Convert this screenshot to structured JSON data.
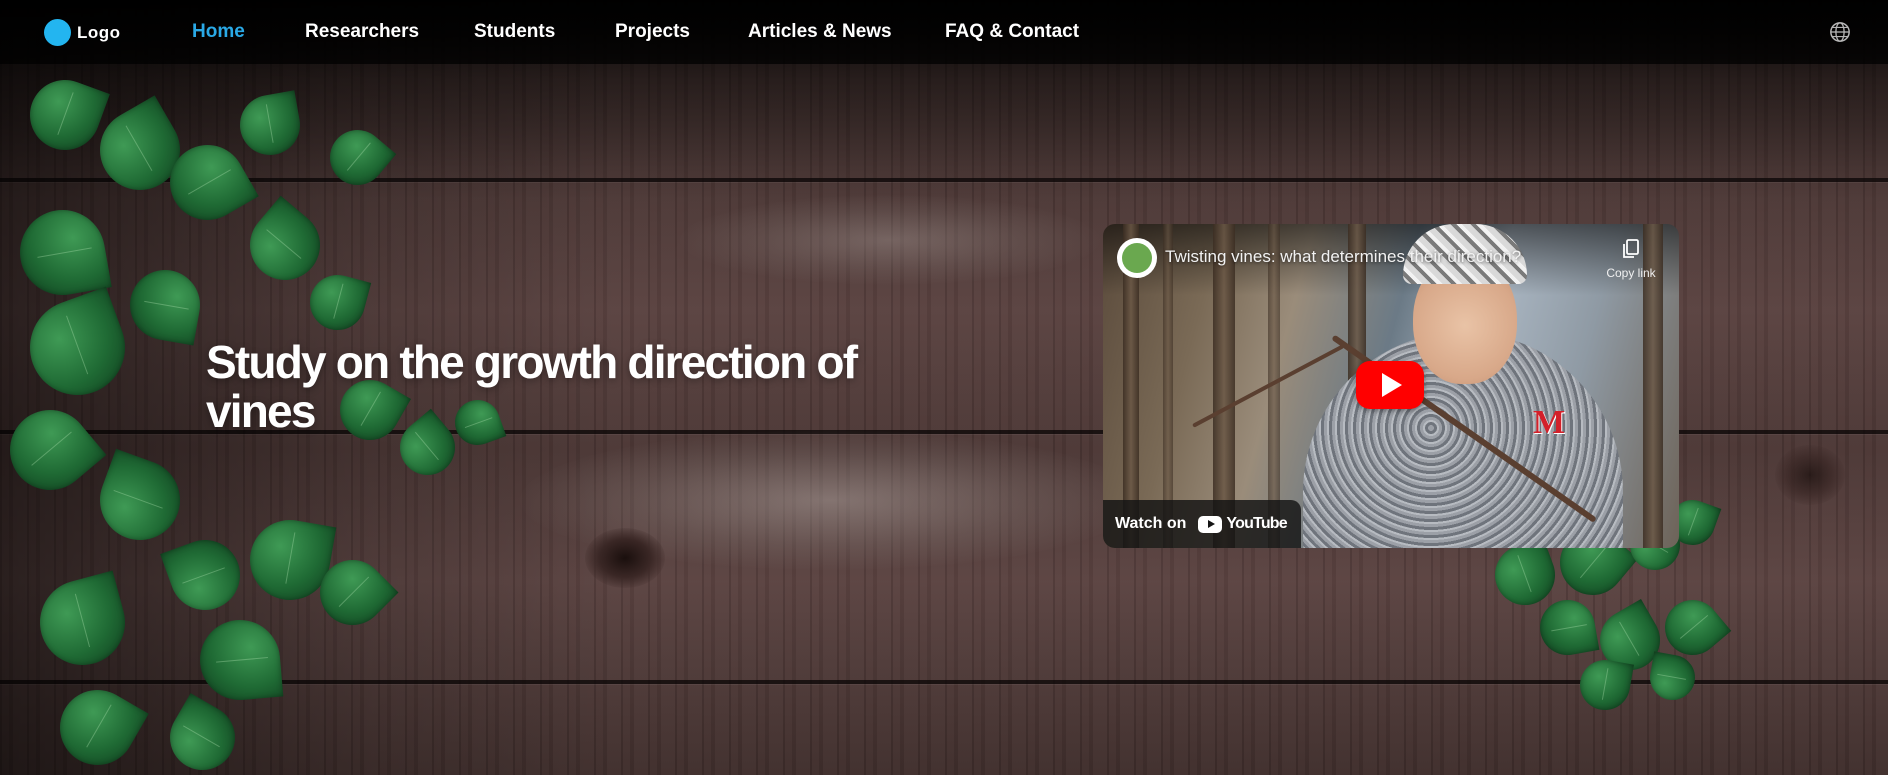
{
  "nav": {
    "logo_text": "Logo",
    "links": [
      {
        "label": "Home",
        "active": true
      },
      {
        "label": "Researchers",
        "active": false
      },
      {
        "label": "Students",
        "active": false
      },
      {
        "label": "Projects",
        "active": false
      },
      {
        "label": "Articles & News",
        "active": false
      },
      {
        "label": "FAQ & Contact",
        "active": false
      }
    ],
    "language_icon": "globe-icon"
  },
  "hero": {
    "title": "Study on the growth direction of vines"
  },
  "video": {
    "title": "Twisting vines: what determines their direction?",
    "copy_link_label": "Copy link",
    "watch_on_label": "Watch on",
    "platform_label": "YouTube",
    "play_icon": "play-icon",
    "copy_icon": "copy-icon"
  },
  "colors": {
    "accent": "#2aa9e6",
    "logo_dot": "#23b5f0",
    "play_button": "#ff0000"
  }
}
